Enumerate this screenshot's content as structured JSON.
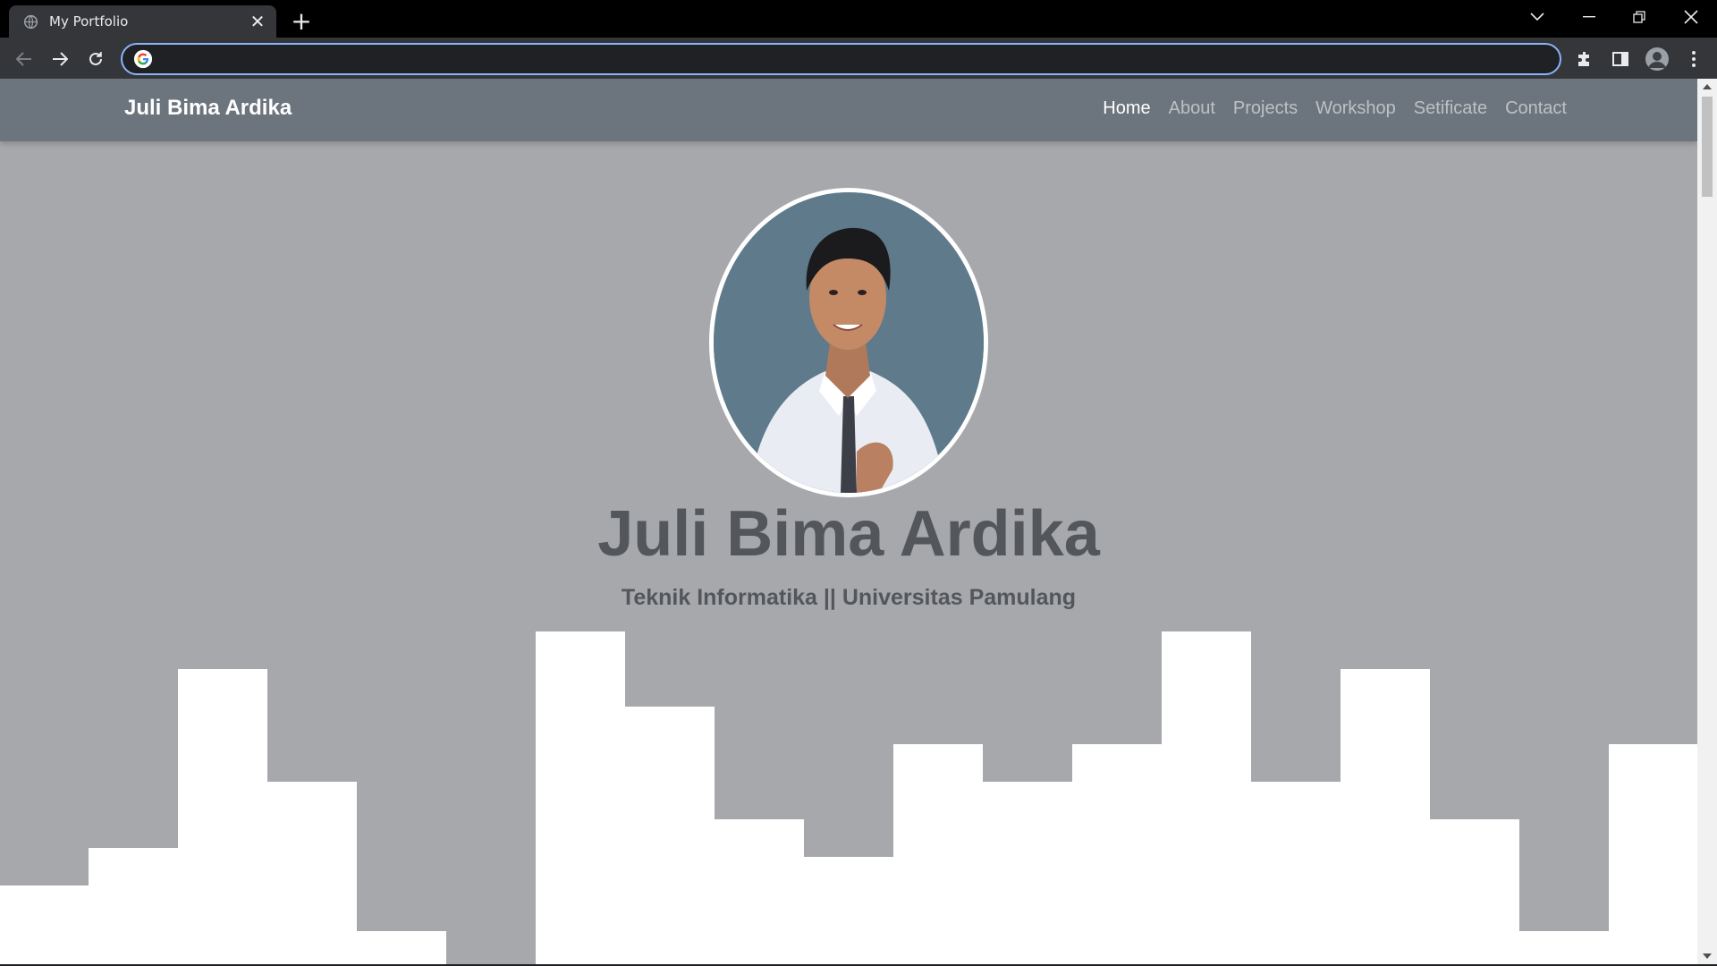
{
  "browser": {
    "tab_title": "My Portfolio",
    "omnibox_value": "",
    "accent": "#8ab4f8"
  },
  "site": {
    "brand": "Juli Bima Ardika",
    "nav": [
      {
        "label": "Home",
        "active": true
      },
      {
        "label": "About",
        "active": false
      },
      {
        "label": "Projects",
        "active": false
      },
      {
        "label": "Workshop",
        "active": false
      },
      {
        "label": "Setificate",
        "active": false
      },
      {
        "label": "Contact",
        "active": false
      }
    ],
    "hero_name": "Juli Bima Ardika",
    "hero_subtitle": "Teknik Informatika || Universitas Pamulang",
    "colors": {
      "page_bg": "#a7a8ac",
      "navbar_bg": "#6c757d",
      "text": "#53575b",
      "skyline": "#ffffff"
    }
  }
}
